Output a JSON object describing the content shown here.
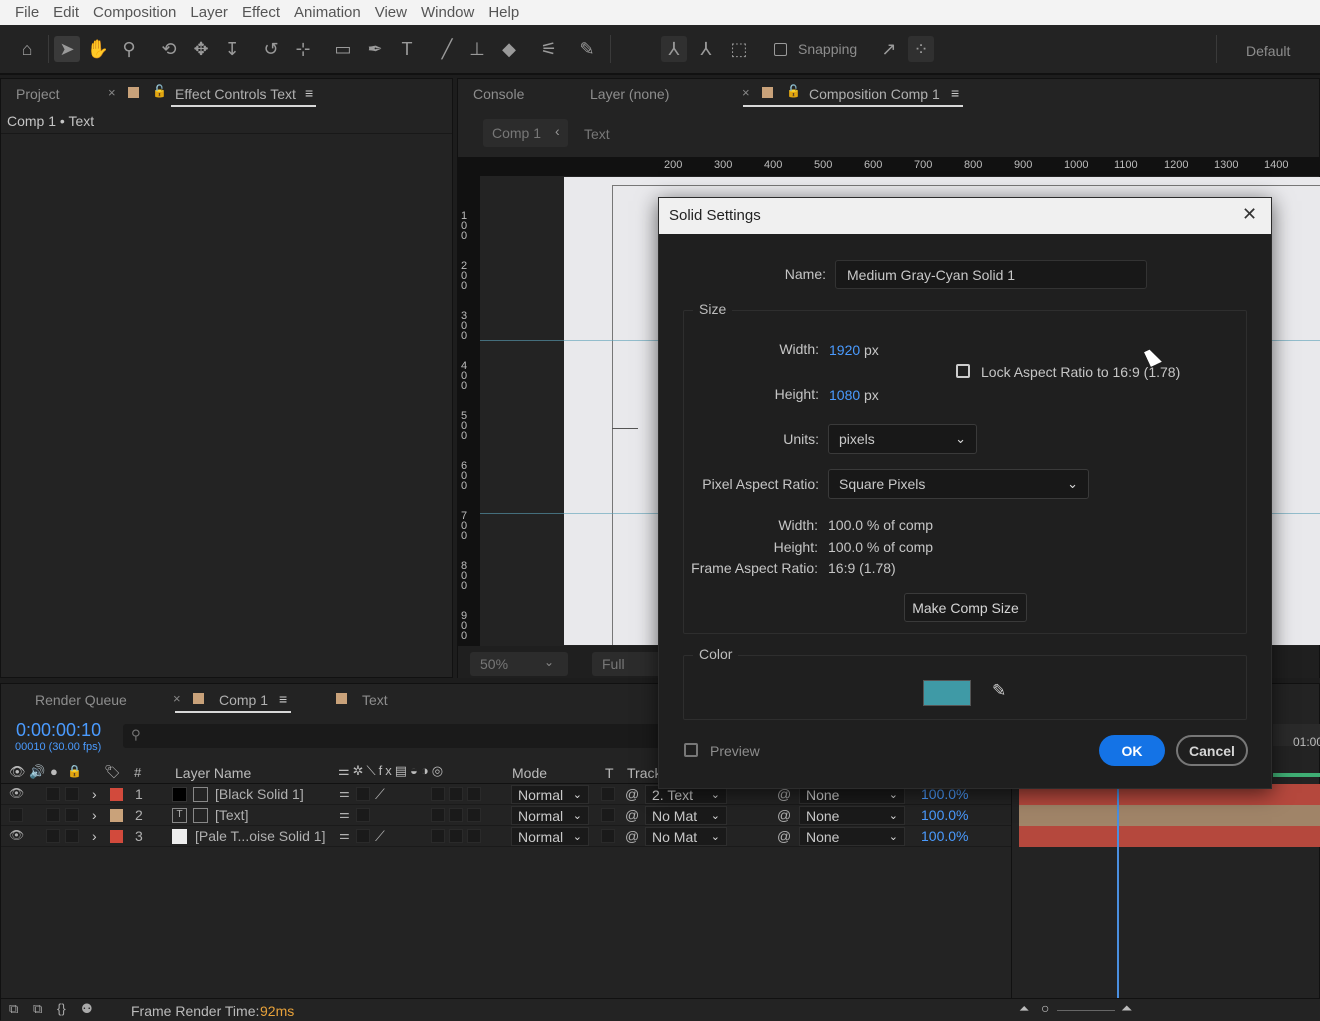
{
  "menubar": {
    "items": [
      "File",
      "Edit",
      "Composition",
      "Layer",
      "Effect",
      "Animation",
      "View",
      "Window",
      "Help"
    ]
  },
  "toolbar": {
    "snapping_label": "Snapping",
    "workspace_label": "Default"
  },
  "project_panel": {
    "tab_project": "Project",
    "tab_effect_controls": "Effect Controls Text",
    "breadcrumb": "Comp 1 • Text"
  },
  "comp_panel": {
    "tab_console": "Console",
    "tab_layer": "Layer (none)",
    "tab_composition": "Composition Comp 1",
    "nav_comp": "Comp 1",
    "nav_layer": "Text",
    "ruler_h": [
      "200",
      "300",
      "400",
      "500",
      "600",
      "700",
      "800",
      "900",
      "1000",
      "1100",
      "1200",
      "1300",
      "1400"
    ],
    "ruler_v": [
      "100",
      "200",
      "300",
      "400",
      "500",
      "600",
      "700",
      "800",
      "900"
    ],
    "zoom": "50%",
    "resolution": "Full"
  },
  "dialog": {
    "title": "Solid Settings",
    "name_label": "Name:",
    "name_value": "Medium Gray-Cyan Solid 1",
    "size_group": "Size",
    "width_label": "Width:",
    "width_value": "1920",
    "height_label": "Height:",
    "height_value": "1080",
    "unit_px": "px",
    "lock_label": "Lock Aspect Ratio to 16:9 (1.78)",
    "units_label": "Units:",
    "units_value": "pixels",
    "par_label": "Pixel Aspect Ratio:",
    "par_value": "Square Pixels",
    "pct_width_label": "Width:",
    "pct_width_value": "100.0 % of comp",
    "pct_height_label": "Height:",
    "pct_height_value": "100.0 % of comp",
    "far_label": "Frame Aspect Ratio:",
    "far_value": "16:9 (1.78)",
    "make_comp_size": "Make Comp Size",
    "color_group": "Color",
    "color_swatch": "#3f9aa6",
    "preview_label": "Preview",
    "ok_label": "OK",
    "cancel_label": "Cancel"
  },
  "timeline": {
    "tab_render_queue": "Render Queue",
    "tab_comp": "Comp 1",
    "tab_text": "Text",
    "timecode": "0:00:00:10",
    "frame_info": "00010 (30.00 fps)",
    "col_num": "#",
    "col_layer_name": "Layer Name",
    "col_mode": "Mode",
    "col_t": "T",
    "col_track": "Track",
    "time_marker": "01:00",
    "layers": [
      {
        "num": "1",
        "name": "[Black Solid 1]",
        "mode": "Normal",
        "track": "2. Text",
        "parent": "None",
        "stretch": "100.0%",
        "label_color": "#d24a3c"
      },
      {
        "num": "2",
        "name": "[Text]",
        "mode": "Normal",
        "track": "No Mat",
        "parent": "None",
        "stretch": "100.0%",
        "label_color": "#c9a27a"
      },
      {
        "num": "3",
        "name": "[Pale T...oise Solid 1]",
        "mode": "Normal",
        "track": "No Mat",
        "parent": "None",
        "stretch": "100.0%",
        "label_color": "#d24a3c"
      }
    ],
    "footer_label": "Frame Render Time:",
    "footer_value": "92ms"
  }
}
